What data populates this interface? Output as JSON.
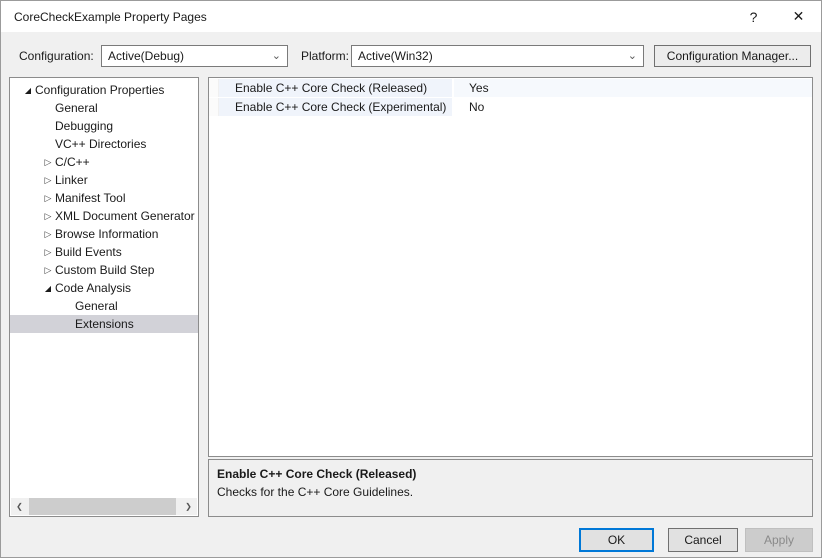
{
  "window": {
    "title": "CoreCheckExample Property Pages",
    "help_glyph": "?",
    "close_glyph": "✕"
  },
  "icons": {
    "expanded": "◢",
    "collapsed": "▷",
    "dropdown": "⌄",
    "scroll_left": "❮",
    "scroll_right": "❯"
  },
  "toolbar": {
    "configuration_label": "Configuration:",
    "configuration_value": "Active(Debug)",
    "platform_label": "Platform:",
    "platform_value": "Active(Win32)",
    "config_manager_label": "Configuration Manager..."
  },
  "tree": {
    "items": [
      {
        "label": "Configuration Properties",
        "level": 0,
        "state": "expanded"
      },
      {
        "label": "General",
        "level": 1
      },
      {
        "label": "Debugging",
        "level": 1
      },
      {
        "label": "VC++ Directories",
        "level": 1
      },
      {
        "label": "C/C++",
        "level": 1,
        "state": "collapsed"
      },
      {
        "label": "Linker",
        "level": 1,
        "state": "collapsed"
      },
      {
        "label": "Manifest Tool",
        "level": 1,
        "state": "collapsed"
      },
      {
        "label": "XML Document Generator",
        "level": 1,
        "state": "collapsed"
      },
      {
        "label": "Browse Information",
        "level": 1,
        "state": "collapsed"
      },
      {
        "label": "Build Events",
        "level": 1,
        "state": "collapsed"
      },
      {
        "label": "Custom Build Step",
        "level": 1,
        "state": "collapsed"
      },
      {
        "label": "Code Analysis",
        "level": 1,
        "state": "expanded"
      },
      {
        "label": "General",
        "level": 2
      },
      {
        "label": "Extensions",
        "level": 2,
        "selected": true
      }
    ]
  },
  "grid": {
    "rows": [
      {
        "name": "Enable C++ Core Check (Released)",
        "value": "Yes",
        "tinted": true
      },
      {
        "name": "Enable C++ Core Check (Experimental)",
        "value": "No"
      }
    ]
  },
  "description": {
    "title": "Enable C++ Core Check (Released)",
    "body": "Checks for the C++ Core Guidelines."
  },
  "footer": {
    "ok_label": "OK",
    "cancel_label": "Cancel",
    "apply_label": "Apply"
  },
  "colors": {
    "accent": "#0078d7",
    "dialog_bg": "#f0f0f0",
    "tree_selected_bg": "#d2d2d8",
    "grid_name_bg": "#f0f4fb"
  }
}
